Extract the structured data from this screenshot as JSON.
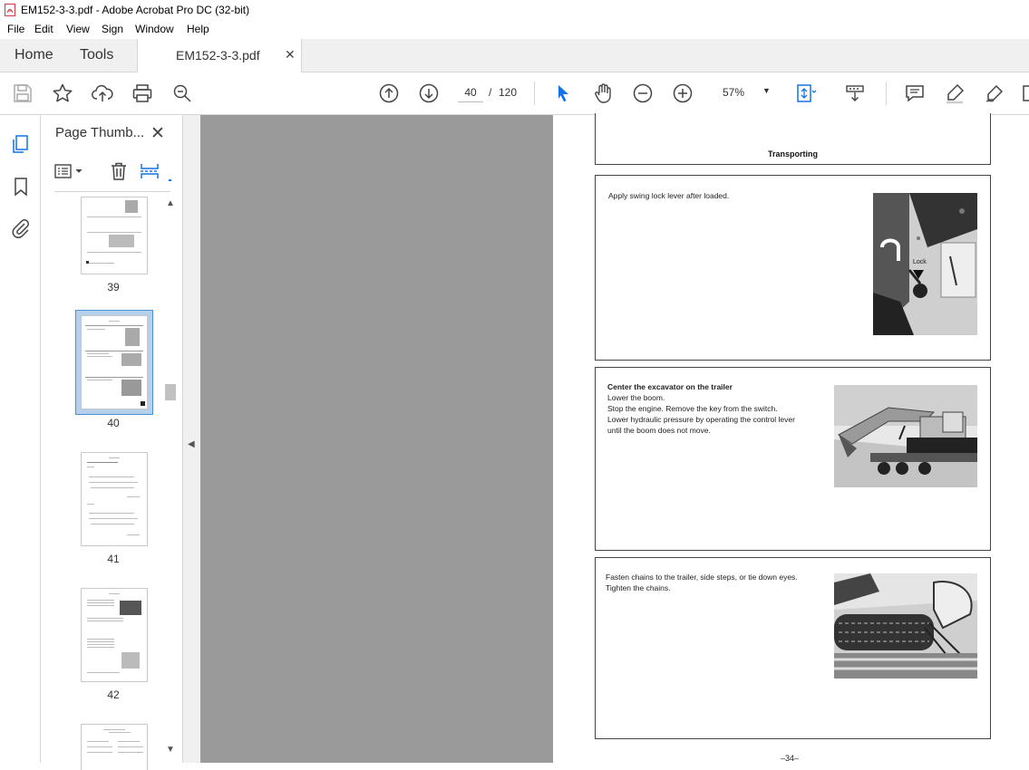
{
  "window": {
    "title": "EM152-3-3.pdf - Adobe Acrobat Pro DC (32-bit)"
  },
  "menu": {
    "items": [
      "File",
      "Edit",
      "View",
      "Sign",
      "Window",
      "Help"
    ]
  },
  "tabs": {
    "home": "Home",
    "tools": "Tools",
    "document": "EM152-3-3.pdf"
  },
  "toolbar": {
    "current_page": "40",
    "page_separator": "/",
    "total_pages": "120",
    "zoom": "57%",
    "icons": [
      "save-icon",
      "star-icon",
      "upload-icon",
      "print-icon",
      "find-icon",
      "page-up-icon",
      "page-down-icon",
      "select-arrow-icon",
      "hand-icon",
      "zoom-out-icon",
      "zoom-in-icon",
      "fit-page-icon",
      "scroll-mode-icon",
      "comment-icon",
      "highlight-icon",
      "draw-icon"
    ]
  },
  "left_rail": {
    "icons": [
      "pages-icon",
      "bookmark-icon",
      "attachment-icon"
    ]
  },
  "thumbnails_panel": {
    "title": "Page Thumb...",
    "pages": [
      {
        "number": "39"
      },
      {
        "number": "40",
        "selected": true
      },
      {
        "number": "41"
      },
      {
        "number": "42"
      }
    ]
  },
  "document": {
    "header": "Transporting",
    "section1": {
      "text": "Apply swing lock lever after loaded.",
      "photo_label": "Lock"
    },
    "section2": {
      "heading": "Center the excavator on the trailer",
      "lines": [
        "Lower the boom.",
        "Stop the engine. Remove the key from the switch.",
        "Lower hydraulic pressure by operating the control lever",
        "until the boom does not move."
      ]
    },
    "section3": {
      "lines": [
        "Fasten chains to the trailer, side steps, or tie down eyes.",
        "Tighten the chains."
      ]
    },
    "page_number": "–34–"
  },
  "colors": {
    "accent": "#1473e6",
    "doc_background": "#9a9a9a",
    "pdf_icon": "#d7373f",
    "selected_thumb": "#b4d0ea"
  }
}
